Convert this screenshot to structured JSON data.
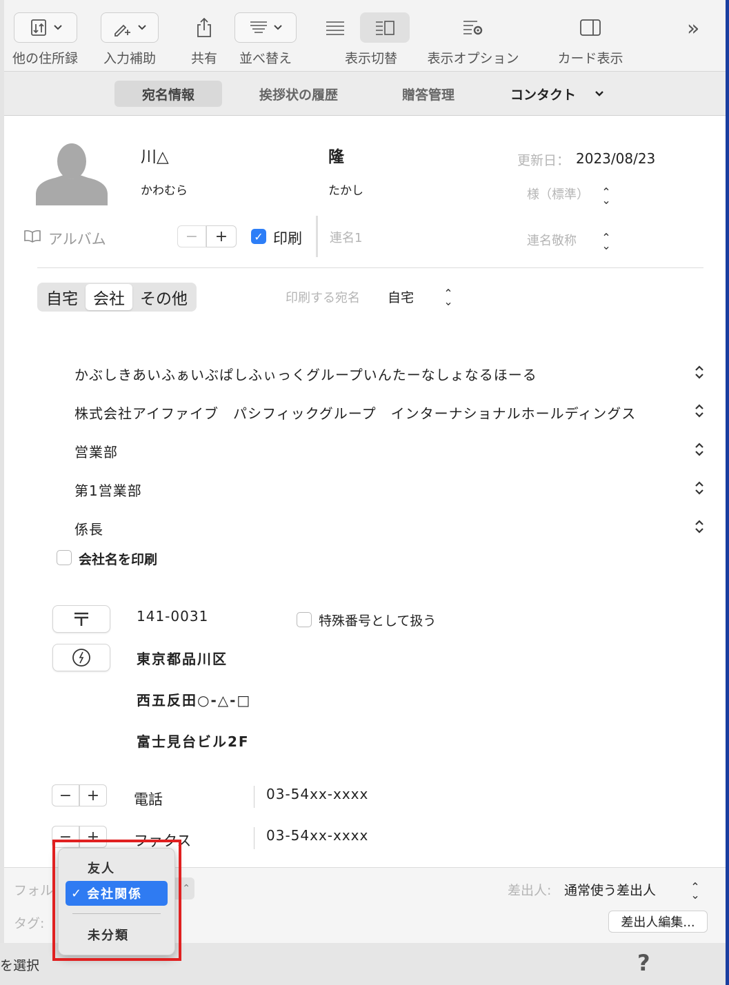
{
  "toolbar": {
    "items": [
      {
        "label": "他の住所録",
        "icon": "import-export-icon",
        "has_dropdown": true
      },
      {
        "label": "入力補助",
        "icon": "pen-add-icon",
        "has_dropdown": true
      },
      {
        "label": "共有",
        "icon": "share-icon",
        "has_dropdown": false
      },
      {
        "label": "並べ替え",
        "icon": "sort-lines-icon",
        "has_dropdown": true
      },
      {
        "label": "表示切替",
        "icon": "list-view-icon",
        "has_dropdown": false
      },
      {
        "label": "表示オプション",
        "icon": "list-gear-icon",
        "has_dropdown": false
      },
      {
        "label": "カード表示",
        "icon": "sidebar-right-icon",
        "has_dropdown": false
      }
    ],
    "overflow": "»"
  },
  "tabs": [
    {
      "label": "宛名情報",
      "active": true
    },
    {
      "label": "挨拶状の履歴",
      "active": false
    },
    {
      "label": "贈答管理",
      "active": false
    },
    {
      "label": "コンタクト",
      "active": false
    }
  ],
  "person": {
    "family_name": "川△",
    "given_name": "隆",
    "family_kana": "かわむら",
    "given_kana": "たかし",
    "updated_label": "更新日：",
    "updated_date": "2023/08/23",
    "honorific": "様（標準）",
    "album_label": "アルバム",
    "print_label": "印刷",
    "print_checked": true,
    "joint_name_placeholder": "連名1",
    "joint_honorific_placeholder": "連名敬称"
  },
  "address_tabs": {
    "options": [
      "自宅",
      "会社",
      "その他"
    ],
    "selected": "会社",
    "print_target_label": "印刷する宛名",
    "print_target_value": "自宅"
  },
  "company": {
    "kana": "かぶしきあいふぁいぶぱしふぃっくグループいんたーなしょなるほーる",
    "name": "株式会社アイファイブ　パシフィックグループ　インターナショナルホールディングス",
    "department": "営業部",
    "section": "第1営業部",
    "title": "係長",
    "print_company_label": "会社名を印刷",
    "print_company_checked": false
  },
  "address": {
    "postal": "141-0031",
    "special_label": "特殊番号として扱う",
    "special_checked": false,
    "line1": "東京都品川区",
    "line2": "西五反田○-△-□",
    "line3": "富士見台ビル2F"
  },
  "contacts": [
    {
      "label": "電話",
      "value": "03-54xx-xxxx"
    },
    {
      "label": "ファクス",
      "value": "03-54xx-xxxx"
    }
  ],
  "bottom": {
    "folder_label": "フォル",
    "tag_label": "タグ:",
    "sender_label": "差出人:",
    "sender_value": "通常使う差出人",
    "sender_edit": "差出人編集..."
  },
  "footer": {
    "select_text": "を選択",
    "help": "?"
  },
  "folder_menu": {
    "items": [
      "友人",
      "会社関係",
      "未分類"
    ],
    "selected": "会社関係"
  }
}
